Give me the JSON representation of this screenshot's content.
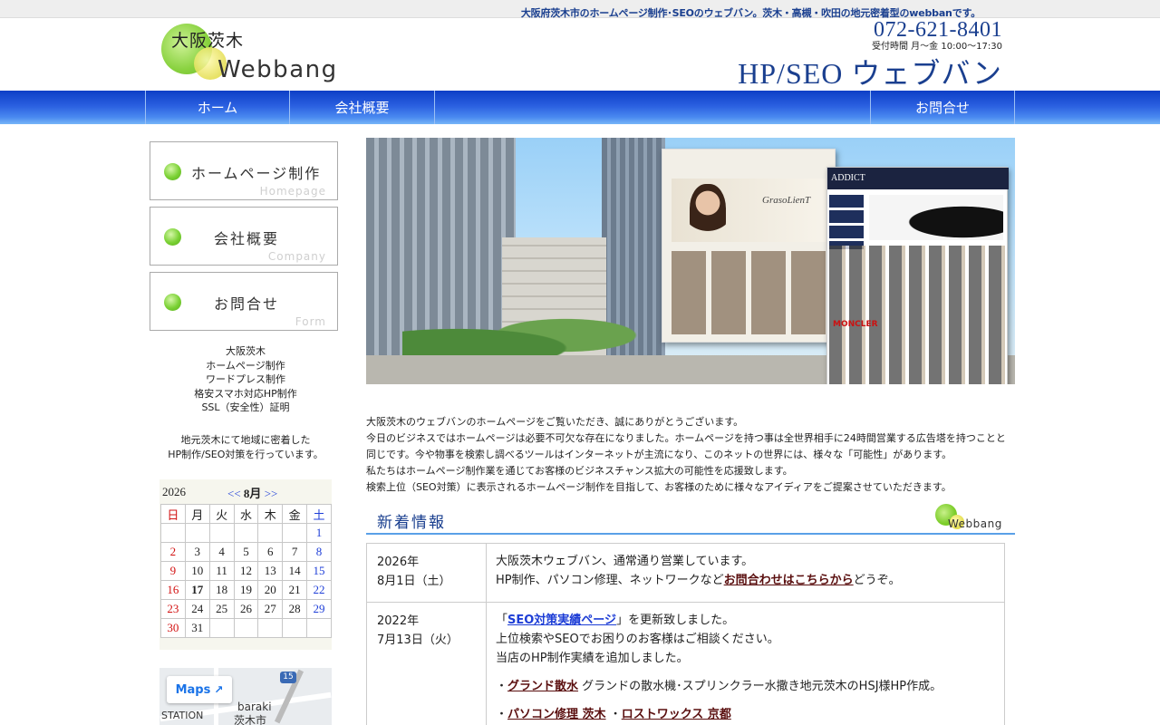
{
  "topbar": {
    "tagline": "大阪府茨木市のホームページ制作･SEOのウェブバン。茨木・高槻・吹田の地元密着型のwebbanです。"
  },
  "header": {
    "logo_line1": "大阪茨木",
    "logo_line2": "Webbang",
    "phone": "072-621-8401",
    "hours": "受付時間 月～金 10:00～17:30",
    "brand": "HP/SEO ウェブバン"
  },
  "nav": {
    "home": "ホーム",
    "company": "会社概要",
    "contact": "お問合せ"
  },
  "sidebar": {
    "buttons": [
      {
        "jp": "ホームページ制作",
        "en": "Homepage"
      },
      {
        "jp": "会社概要",
        "en": "Company"
      },
      {
        "jp": "お問合せ",
        "en": "Form"
      }
    ],
    "services": [
      "大阪茨木",
      "ホームページ制作",
      "ワードプレス制作",
      "格安スマホ対応HP制作",
      "SSL（安全性）証明"
    ],
    "local_text": [
      "地元茨木にて地域に密着した",
      "HP制作/SEO対策を行っています。"
    ]
  },
  "calendar": {
    "year": "2026",
    "prev": "<<",
    "month": "8月",
    "next": ">>",
    "weekdays": [
      "日",
      "月",
      "火",
      "水",
      "木",
      "金",
      "土"
    ],
    "weeks": [
      [
        "",
        "",
        "",
        "",
        "",
        "",
        "1"
      ],
      [
        "2",
        "3",
        "4",
        "5",
        "6",
        "7",
        "8"
      ],
      [
        "9",
        "10",
        "11",
        "12",
        "13",
        "14",
        "15"
      ],
      [
        "16",
        "17",
        "18",
        "19",
        "20",
        "21",
        "22"
      ],
      [
        "23",
        "24",
        "25",
        "26",
        "27",
        "28",
        "29"
      ],
      [
        "30",
        "31",
        "",
        "",
        "",
        "",
        ""
      ]
    ],
    "today": "17"
  },
  "map": {
    "button": "Maps",
    "label1": "baraki",
    "label2": "STATION",
    "label3": "茨木市",
    "route": "15"
  },
  "hero": {
    "shot1_logo": "GrasoLienT",
    "shot2_title": "ADDICT",
    "shot2_promo": "MONCLER"
  },
  "intro": [
    "大阪茨木のウェブバンのホームページをご覧いただき、誠にありがとうございます。",
    "今日のビジネスではホームページは必要不可欠な存在になりました。ホームページを持つ事は全世界相手に24時間営業する広告塔を持つことと同じです。今や物事を検索し調べるツールはインターネットが主流になり、このネットの世界には、様々な「可能性」があります。",
    "私たちはホームページ制作業を通じてお客様のビジネスチャンス拡大の可能性を応援致します。",
    "検索上位（SEO対策）に表示されるホームページ制作を目指して、お客様のために様々なアイディアをご提案させていただきます。"
  ],
  "news": {
    "heading": "新着情報",
    "logo": "Webbang",
    "items": [
      {
        "year": "2026年",
        "date": "8月1日（土）",
        "line1": "大阪茨木ウェブバン、通常通り営業しています。",
        "line2_pre": "HP制作、パソコン修理、ネットワークなど",
        "line2_link": "お問合わせはこちらから",
        "line2_post": "どうぞ。"
      },
      {
        "year": "2022年",
        "date": "7月13日（火）",
        "q_open": "「",
        "link_seo": "SEO対策実績ページ",
        "q_close": "」を更新致しました。",
        "line2": "上位検索やSEOでお困りのお客様はご相談ください。",
        "line3": "当店のHP制作実績を追加しました。",
        "b1_dot": "・",
        "b1_link": "グランド散水",
        "b1_text": " グランドの散水機･スプリンクラー水撒き地元茨木のHSJ様HP作成。",
        "b2_dot": "・",
        "b2_link1": "パソコン修理 茨木",
        "b2_sep": " ・",
        "b2_link2": "ロストワックス 京都"
      }
    ]
  },
  "colors": {
    "brand_blue": "#1a3f8f",
    "nav_blue": "#2a5fe0",
    "sunday": "#d21111",
    "saturday": "#1f3fd8",
    "link_dark": "#5a0f0f"
  }
}
